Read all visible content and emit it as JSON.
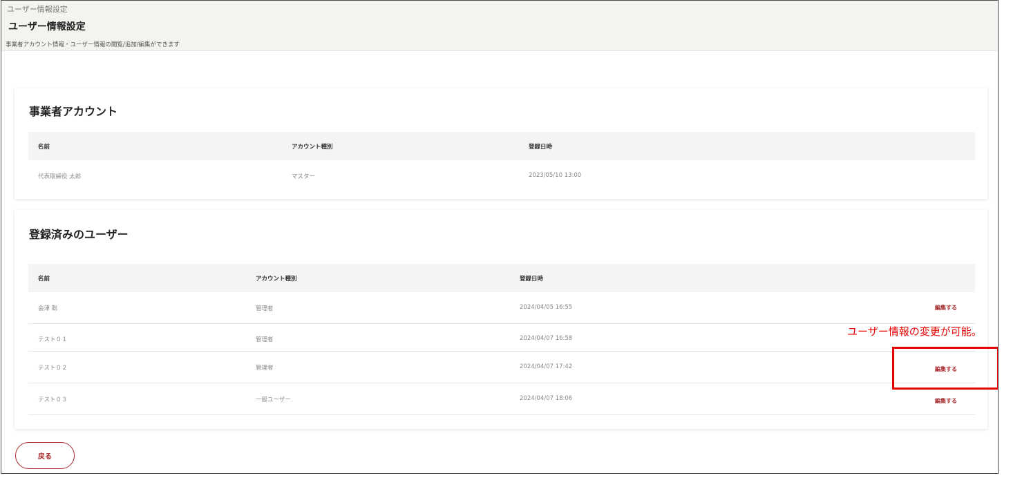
{
  "header": {
    "breadcrumb": "ユーザー情報設定",
    "title": "ユーザー情報設定",
    "description": "事業者アカウント情報・ユーザー情報の閲覧/追加/編集ができます"
  },
  "business_account": {
    "title": "事業者アカウント",
    "columns": [
      "名前",
      "アカウント種別",
      "登録日時"
    ],
    "rows": [
      {
        "name": "代表取締役 太郎",
        "type": "マスター",
        "registered": "2023/05/10 13:00"
      }
    ]
  },
  "registered_users": {
    "title": "登録済みのユーザー",
    "columns": [
      "名前",
      "アカウント種別",
      "登録日時"
    ],
    "edit_label": "編集する",
    "rows": [
      {
        "name": "会津 聡",
        "type": "管理者",
        "registered": "2024/04/05 16:55",
        "edit": "編集する"
      },
      {
        "name": "テスト０１",
        "type": "管理者",
        "registered": "2024/04/07 16:58",
        "edit": ""
      },
      {
        "name": "テスト０２",
        "type": "管理者",
        "registered": "2024/04/07 17:42",
        "edit": "編集する"
      },
      {
        "name": "テスト０３",
        "type": "一般ユーザー",
        "registered": "2024/04/07 18:06",
        "edit": "編集する"
      }
    ]
  },
  "back_button_label": "戻る",
  "annotation": {
    "text": "ユーザー情報の変更が可能。",
    "color": "#e60000"
  },
  "colors": {
    "accent": "#a8282c",
    "header_bg": "#f1f4ef"
  }
}
